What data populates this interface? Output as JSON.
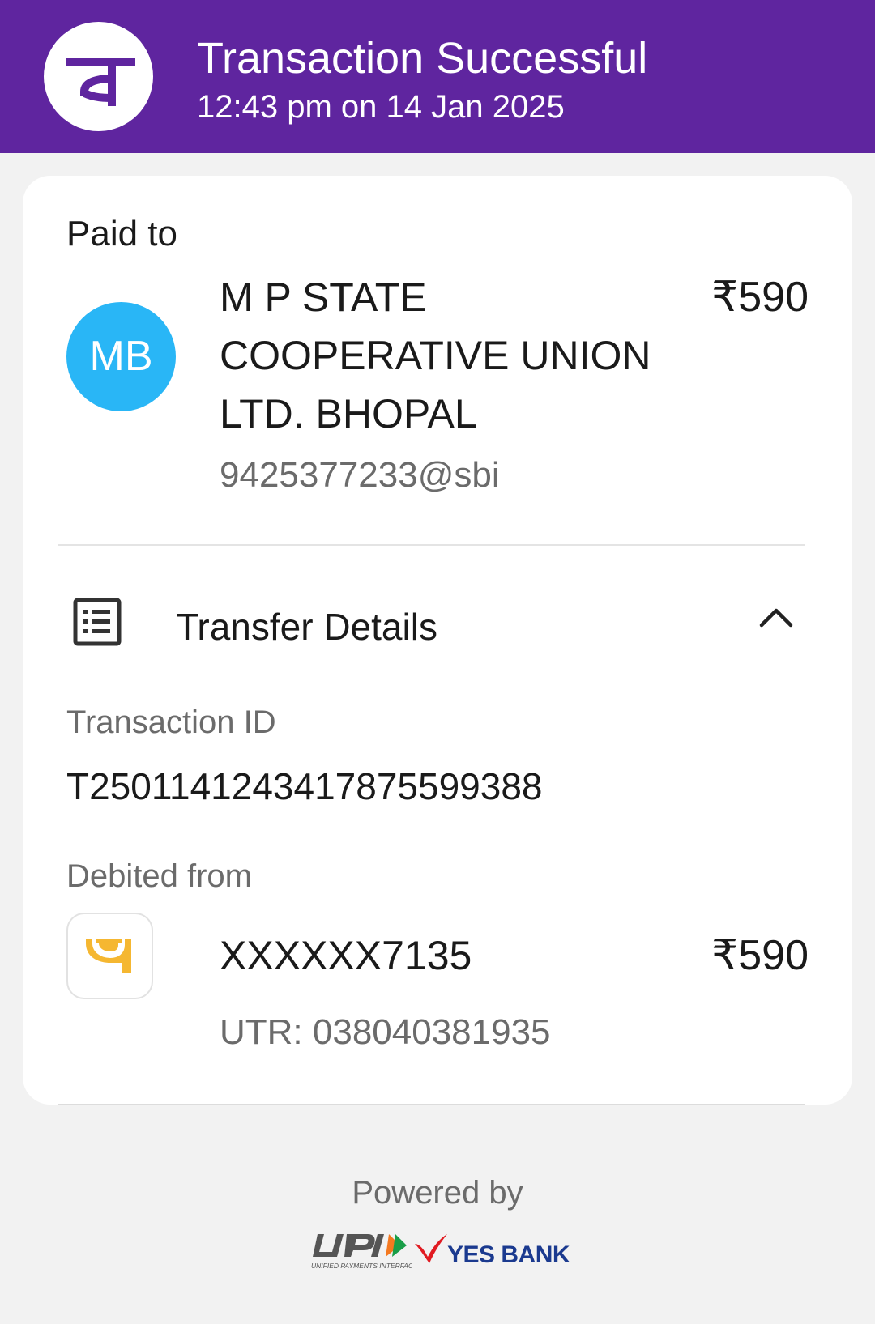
{
  "header": {
    "title": "Transaction Successful",
    "datetime": "12:43 pm on 14 Jan 2025",
    "logo_icon": "phonepe-logo-icon",
    "background_color": "#5f259f"
  },
  "paid_to": {
    "label": "Paid to",
    "avatar_initials": "MB",
    "avatar_color": "#29b6f6",
    "name": "M P STATE COOPERATIVE UNION LTD. BHOPAL",
    "upi_id": "9425377233@sbi",
    "amount": "₹590"
  },
  "transfer_details": {
    "title": "Transfer Details",
    "icon": "receipt-list-icon",
    "toggle_icon": "chevron-up-icon",
    "transaction_id_label": "Transaction ID",
    "transaction_id": "T2501141243417875599388",
    "debited_from_label": "Debited from",
    "bank_icon": "pnb-bank-logo-icon",
    "account_number": "XXXXXX7135",
    "debited_amount": "₹590",
    "utr": "UTR: 038040381935"
  },
  "footer": {
    "powered_by": "Powered by",
    "upi_logo": "upi-logo",
    "upi_subtext": "UNIFIED PAYMENTS INTERFACE",
    "bank_logo": "yes-bank-logo",
    "bank_name": "YES BANK"
  }
}
